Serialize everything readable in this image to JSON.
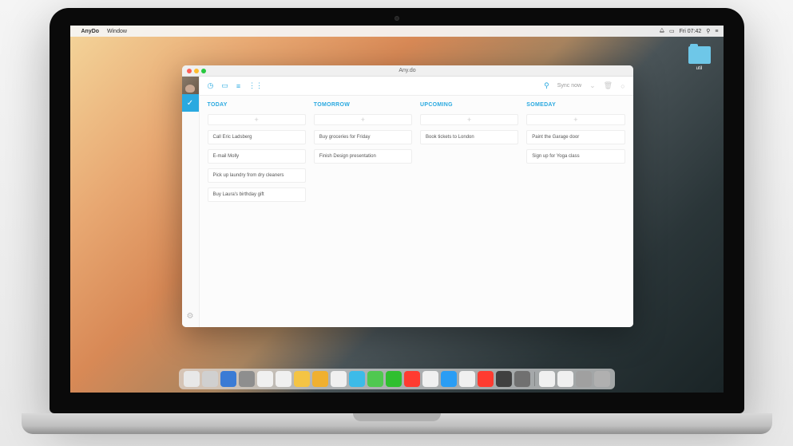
{
  "menubar": {
    "app_name": "AnyDo",
    "menu_window": "Window",
    "clock": "Fri 07:42"
  },
  "desktop": {
    "folder_label": "util"
  },
  "window": {
    "title": "Any.do"
  },
  "toolbar": {
    "sync_label": "Sync now"
  },
  "columns": [
    {
      "header": "TODAY",
      "tasks": [
        "Call Eric Ladsberg",
        "E-mail Molly",
        "Pick up laundry from dry cleaners",
        "Buy Laura's birthday gift"
      ]
    },
    {
      "header": "TOMORROW",
      "tasks": [
        "Buy groceries for Friday",
        "Finish Design presentation"
      ]
    },
    {
      "header": "UPCOMING",
      "tasks": [
        "Book tickets to London"
      ]
    },
    {
      "header": "SOMEDAY",
      "tasks": [
        "Paint the Garage door",
        "Sign up for Yoga class"
      ]
    }
  ],
  "dock_colors": [
    "#e8e8e8",
    "#d0d0d0",
    "#3a7bd5",
    "#8e8e8e",
    "#f0f0f0",
    "#f0f0f0",
    "#f4c444",
    "#f0b030",
    "#f0f0f0",
    "#3cbbe8",
    "#50c850",
    "#2fbf2f",
    "#ff3b30",
    "#f0f0f0",
    "#2a9df4",
    "#f0f0f0",
    "#ff3b30",
    "#404040",
    "#707070",
    "#f0f0f0",
    "#f0f0f0",
    "#a0a0a0",
    "#b0b0b0"
  ]
}
